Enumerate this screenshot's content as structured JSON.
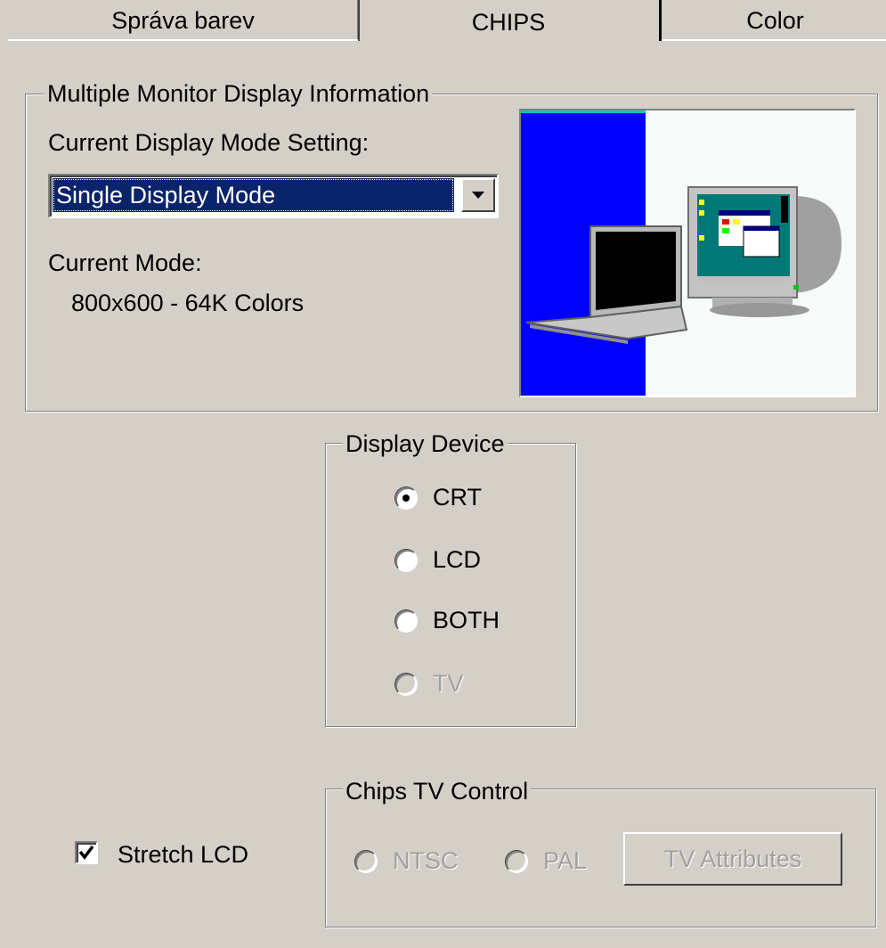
{
  "tabs": {
    "left": "Správa barev",
    "active": "CHIPS",
    "right": "Color"
  },
  "multi_monitor": {
    "legend": "Multiple Monitor Display Information",
    "mode_setting_label": "Current Display Mode Setting:",
    "selected_mode": "Single Display Mode",
    "current_mode_label": "Current Mode:",
    "current_mode_value": "800x600 - 64K Colors"
  },
  "display_device": {
    "legend": "Display Device",
    "options": [
      "CRT",
      "LCD",
      "BOTH",
      "TV"
    ],
    "selected": "CRT"
  },
  "stretch_lcd": {
    "label": "Stretch LCD",
    "checked": true
  },
  "tv_control": {
    "legend": "Chips TV Control",
    "ntsc": "NTSC",
    "pal": "PAL",
    "button": "TV Attributes"
  },
  "colors": {
    "face": "#d4d0c8",
    "highlight": "#0a246a",
    "preview_panel": "#0000ff"
  },
  "icons": [
    "dropdown-arrow-icon",
    "laptop-icon",
    "crt-monitor-icon",
    "checkmark-icon"
  ]
}
